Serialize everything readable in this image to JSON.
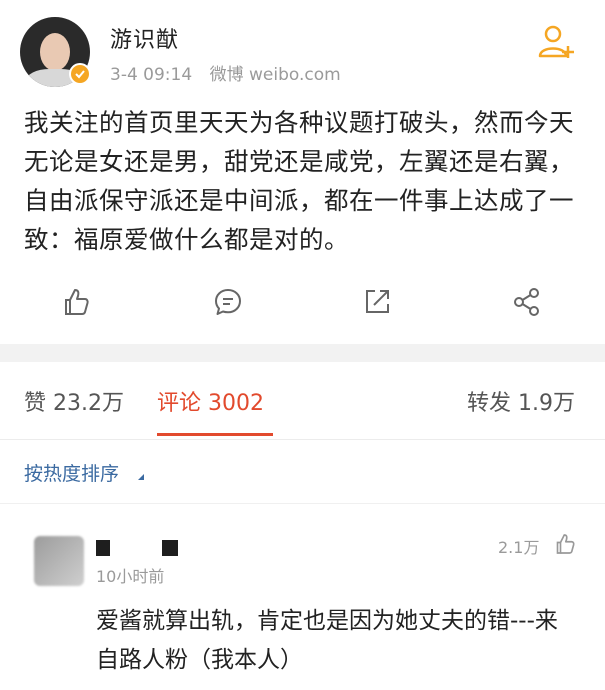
{
  "post": {
    "username": "游识猷",
    "date": "3-4 09:14",
    "source": "微博 weibo.com",
    "text": "我关注的首页里天天为各种议题打破头，然而今天无论是女还是男，甜党还是咸党，左翼还是右翼，自由派保守派还是中间派，都在一件事上达成了一致：福原爱做什么都是对的。",
    "icons": {
      "follow": "add-user-icon",
      "verified": "verified-badge-icon",
      "like": "thumbs-up-icon",
      "comment": "comment-icon",
      "repost": "repost-icon",
      "share": "share-icon"
    }
  },
  "tabs": {
    "likes": "赞 23.2万",
    "comments": "评论 3002",
    "reposts": "转发 1.9万"
  },
  "sort": {
    "label": "按热度排序"
  },
  "comment": {
    "time": "10小时前",
    "likes": "2.1万",
    "text": "爱酱就算出轨，肯定也是因为她丈夫的错---来自路人粉（我本人）"
  },
  "colors": {
    "accent": "#e24a2d",
    "follow": "#f5a623",
    "link": "#3b6aa1",
    "muted": "#9a9a9a"
  }
}
